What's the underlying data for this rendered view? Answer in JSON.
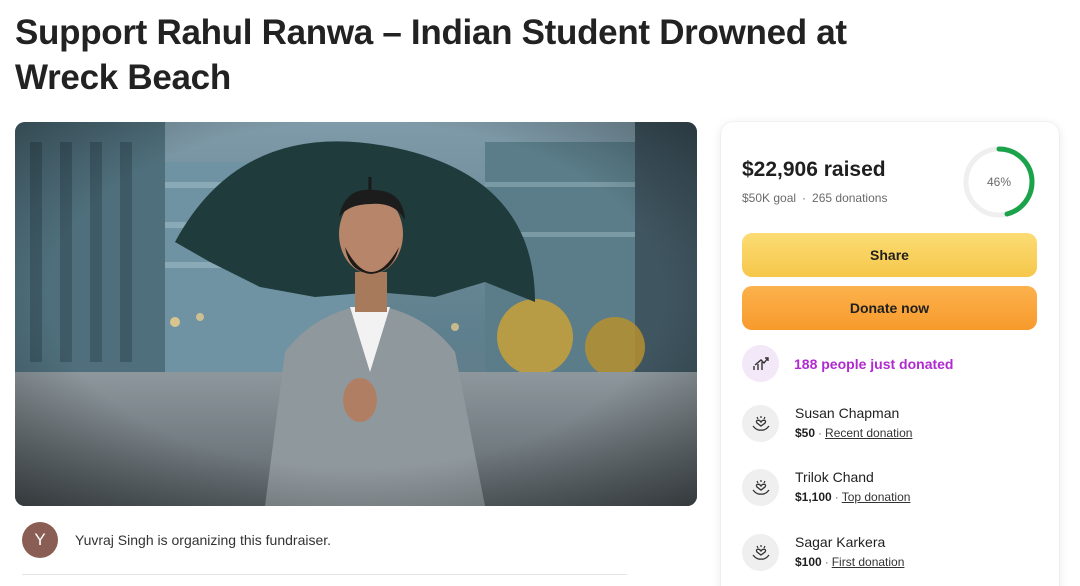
{
  "campaign": {
    "title": "Support Rahul Ranwa – Indian Student Drowned at Wreck Beach"
  },
  "organizer": {
    "avatar_initial": "Y",
    "text": "Yuvraj Singh is organizing this fundraiser."
  },
  "donation_card": {
    "raised": "$22,906 raised",
    "goal": "$50K goal",
    "separator": "·",
    "donations": "265 donations",
    "progress_label": "46%",
    "progress_fraction": 0.46,
    "share_label": "Share",
    "donate_label": "Donate now",
    "recent_count_text": "188 people just donated",
    "accent_color": "#b02ad0",
    "progress_color": "#1aa34a",
    "donors": [
      {
        "name": "Susan Chapman",
        "amount": "$50",
        "separator": "·",
        "tag": "Recent donation"
      },
      {
        "name": "Trilok Chand",
        "amount": "$1,100",
        "separator": "·",
        "tag": "Top donation"
      },
      {
        "name": "Sagar Karkera",
        "amount": "$100",
        "separator": "·",
        "tag": "First donation"
      }
    ]
  },
  "icons": {
    "trend": "trending-up-icon",
    "donor": "heart-hands-icon"
  }
}
